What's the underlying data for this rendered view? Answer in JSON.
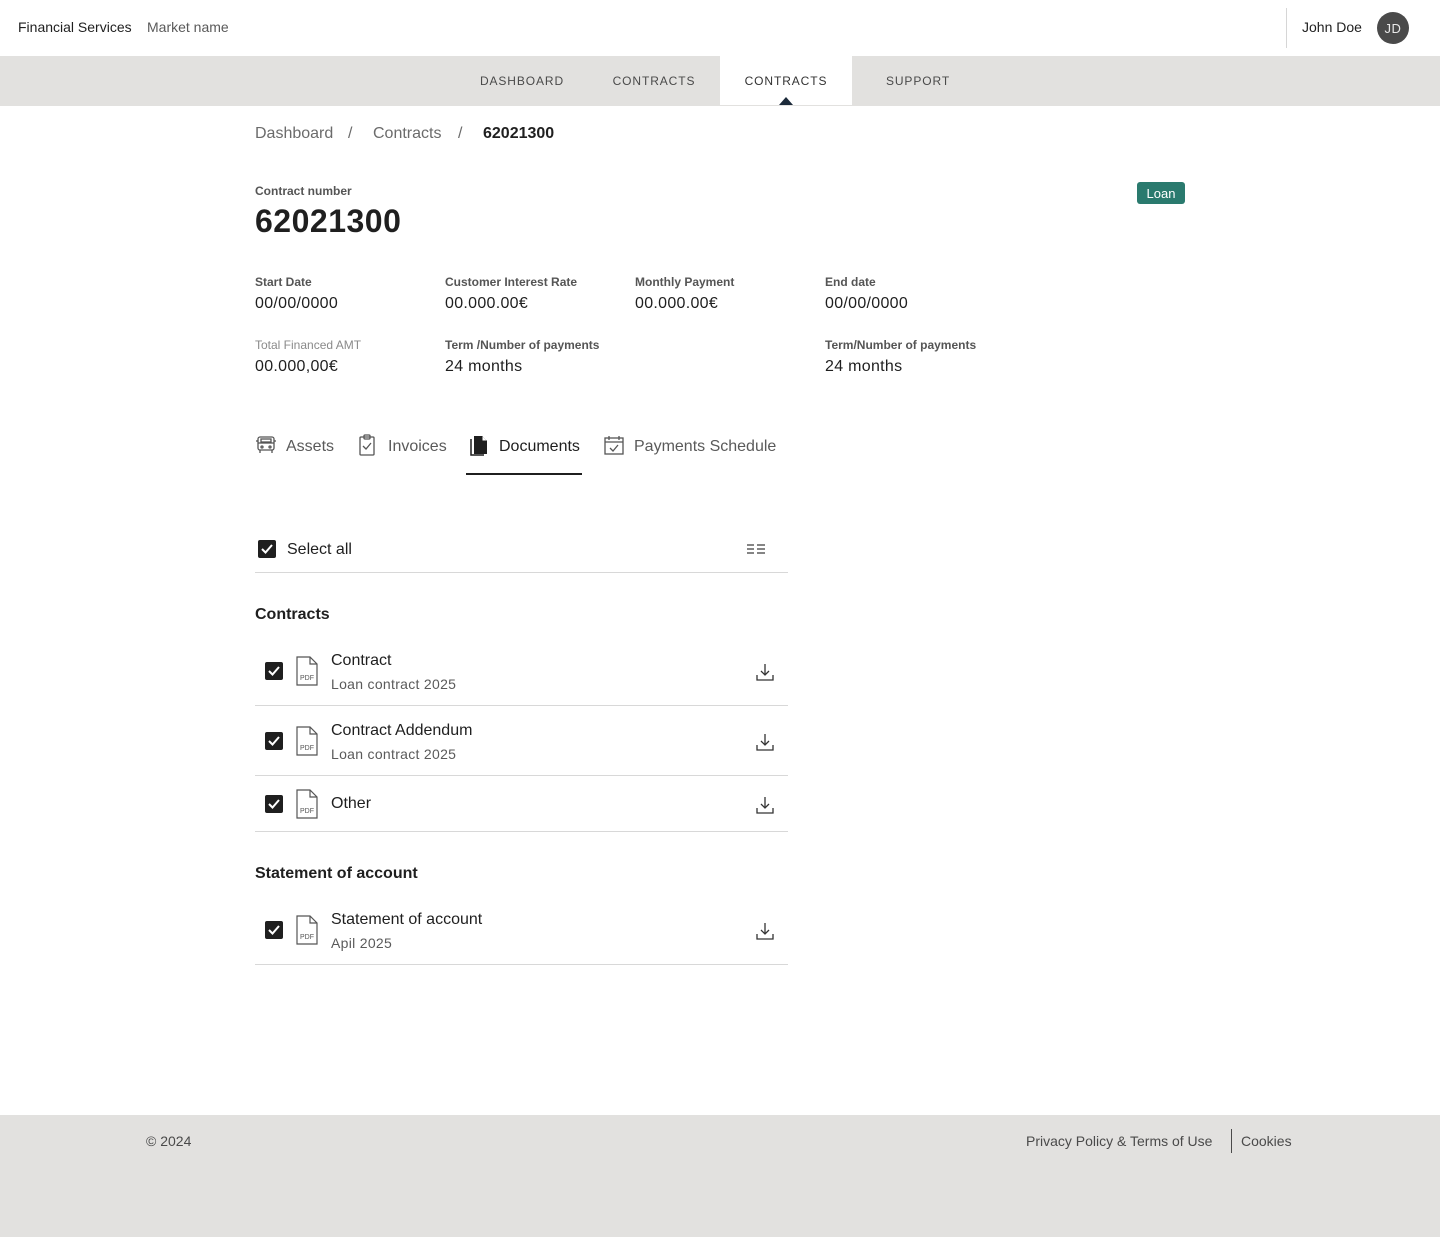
{
  "header": {
    "brand": "Financial Services",
    "market": "Market name",
    "user_name": "John Doe",
    "avatar_initials": "JD"
  },
  "nav": {
    "items": [
      {
        "label": "DASHBOARD",
        "active": false
      },
      {
        "label": "CONTRACTS",
        "active": false
      },
      {
        "label": "CONTRACTS",
        "active": true
      },
      {
        "label": "SUPPORT",
        "active": false
      }
    ]
  },
  "breadcrumb": {
    "items": [
      "Dashboard",
      "Contracts",
      "62021300"
    ],
    "separator": "/"
  },
  "contract": {
    "number_label": "Contract number",
    "number": "62021300",
    "badge": "Loan",
    "badge_color": "#2a7a6e",
    "fields": [
      {
        "label": "Start Date",
        "value": "00/00/0000"
      },
      {
        "label": "Customer Interest Rate",
        "value": "00.000.00€"
      },
      {
        "label": "Monthly Payment",
        "value": "00.000.00€"
      },
      {
        "label": "End date",
        "value": "00/00/0000"
      },
      {
        "label": "Total Financed AMT",
        "value": "00.000,00€"
      },
      {
        "label": "Term /Number of payments",
        "value": "24 months"
      },
      {
        "label": "Term/Number of payments",
        "value": "24 months"
      }
    ]
  },
  "tabs": [
    {
      "label": "Assets",
      "icon": "truck-icon",
      "active": false
    },
    {
      "label": "Invoices",
      "icon": "clipboard-check-icon",
      "active": false
    },
    {
      "label": "Documents",
      "icon": "documents-icon",
      "active": true
    },
    {
      "label": "Payments Schedule",
      "icon": "calendar-check-icon",
      "active": false
    }
  ],
  "documents": {
    "select_all_label": "Select all",
    "select_all_checked": true,
    "sections": [
      {
        "title": "Contracts",
        "items": [
          {
            "title": "Contract",
            "subtitle": "Loan contract 2025",
            "checked": true
          },
          {
            "title": "Contract Addendum",
            "subtitle": "Loan contract 2025",
            "checked": true
          },
          {
            "title": "Other",
            "subtitle": "",
            "checked": true
          }
        ]
      },
      {
        "title": "Statement of account",
        "items": [
          {
            "title": "Statement of account",
            "subtitle": "Apil 2025",
            "checked": true
          }
        ]
      }
    ],
    "pdf_icon_text": "PDF"
  },
  "footer": {
    "copyright": "© 2024",
    "links": [
      "Privacy Policy & Terms of Use",
      "Cookies"
    ]
  }
}
